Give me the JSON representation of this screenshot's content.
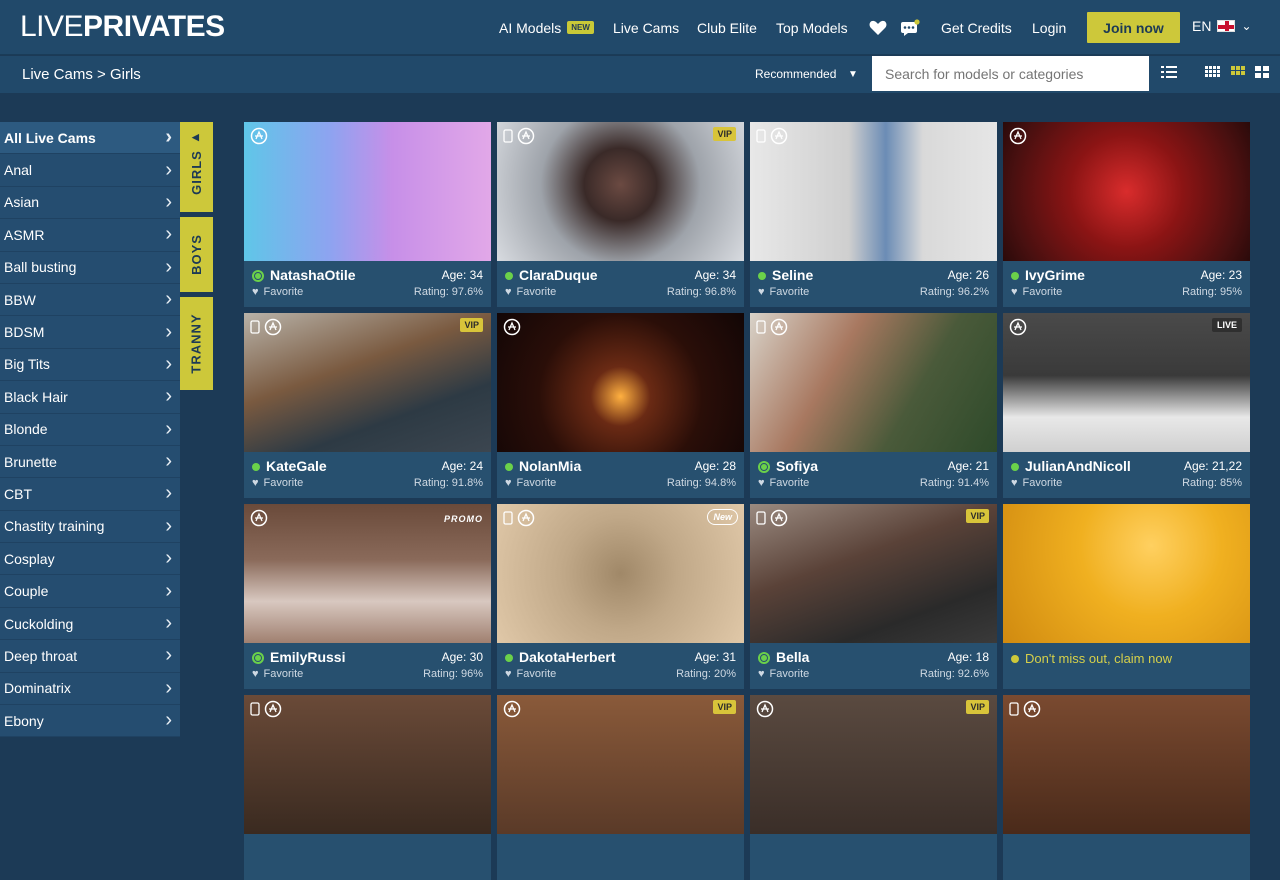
{
  "header": {
    "logo_light": "LIVE",
    "logo_bold": "PRIVATES",
    "nav": [
      {
        "label": "AI Models",
        "badge": "NEW"
      },
      {
        "label": "Live Cams"
      },
      {
        "label": "Club Elite"
      },
      {
        "label": "Top Models"
      },
      {
        "label": "Get Credits"
      },
      {
        "label": "Login"
      }
    ],
    "join_label": "Join now",
    "lang": "EN"
  },
  "subbar": {
    "breadcrumb": "Live Cams > Girls",
    "sort_label": "Recommended",
    "search_placeholder": "Search for models or categories"
  },
  "sidebar": {
    "categories": [
      "All Live Cams",
      "Anal",
      "Asian",
      "ASMR",
      "Ball busting",
      "BBW",
      "BDSM",
      "Big Tits",
      "Black Hair",
      "Blonde",
      "Brunette",
      "CBT",
      "Chastity training",
      "Cosplay",
      "Couple",
      "Cuckolding",
      "Deep throat",
      "Dominatrix",
      "Ebony"
    ],
    "tabs": [
      "GIRLS",
      "BOYS",
      "TRANNY"
    ]
  },
  "models": [
    {
      "name": "NatashaOtile",
      "age": "Age: 34",
      "favorite": "Favorite",
      "rating": "Rating: 97.6%",
      "badge": "",
      "ring": true,
      "bg": "linear-gradient(90deg,#5fc6e8 0%,#8ea3f0 35%,#c78fe8 60%,#e2a8e8 100%)"
    },
    {
      "name": "ClaraDuque",
      "age": "Age: 34",
      "favorite": "Favorite",
      "rating": "Rating: 96.8%",
      "badge": "VIP",
      "ring": false,
      "bg": "radial-gradient(circle at 50% 45%,#6b4a42 0%,#3a2a28 25%,#9ea3aa 55%,#d8dbe0 100%)"
    },
    {
      "name": "Seline",
      "age": "Age: 26",
      "favorite": "Favorite",
      "rating": "Rating: 96.2%",
      "badge": "",
      "ring": false,
      "bg": "linear-gradient(90deg,#e8e8e8 0%,#cfcfcf 40%,#6b8cb5 55%,#d9d9d9 70%,#e6e6e6 100%)"
    },
    {
      "name": "IvyGrime",
      "age": "Age: 23",
      "favorite": "Favorite",
      "rating": "Rating: 95%",
      "badge": "",
      "ring": false,
      "bg": "radial-gradient(circle at 50% 50%,#d92c2c 0%,#8b1414 40%,#4a1010 80%,#2a0a0a 100%)"
    },
    {
      "name": "KateGale",
      "age": "Age: 24",
      "favorite": "Favorite",
      "rating": "Rating: 91.8%",
      "badge": "VIP",
      "ring": false,
      "bg": "linear-gradient(160deg,#b8b2a8 0%,#7a5a40 40%,#2d3a44 70%,#3c4650 100%)"
    },
    {
      "name": "NolanMia",
      "age": "Age: 28",
      "favorite": "Favorite",
      "rating": "Rating: 94.8%",
      "badge": "",
      "ring": false,
      "bg": "radial-gradient(circle at 50% 60%,#ffb040 0%,#6a2a14 20%,#2a0e08 55%,#120606 100%)"
    },
    {
      "name": "Sofiya",
      "age": "Age: 21",
      "favorite": "Favorite",
      "rating": "Rating: 91.4%",
      "badge": "",
      "ring": true,
      "bg": "linear-gradient(120deg,#d8d2c8 0%,#a87860 35%,#4a5a3a 65%,#2e4a2a 100%)"
    },
    {
      "name": "JulianAndNicoll",
      "age": "Age: 21,22",
      "favorite": "Favorite",
      "rating": "Rating: 85%",
      "badge": "LIVE",
      "ring": false,
      "bg": "linear-gradient(180deg,#4a4a4a 0%,#3a3a3a 45%,#e8e8e8 75%,#d0d0d0 100%)"
    },
    {
      "name": "EmilyRussi",
      "age": "Age: 30",
      "favorite": "Favorite",
      "rating": "Rating: 96%",
      "badge": "PROMO",
      "ring": true,
      "bg": "linear-gradient(180deg,#6a4a3a 0%,#8a6a5a 40%,#d8c8c0 70%,#a08070 100%)"
    },
    {
      "name": "DakotaHerbert",
      "age": "Age: 31",
      "favorite": "Favorite",
      "rating": "Rating: 20%",
      "badge": "New",
      "ring": false,
      "bg": "radial-gradient(circle at 50% 50%,#a08868 0%,#c0a888 40%,#e0c8a8 100%)"
    },
    {
      "name": "Bella",
      "age": "Age: 18",
      "favorite": "Favorite",
      "rating": "Rating: 92.6%",
      "badge": "VIP",
      "ring": true,
      "bg": "linear-gradient(160deg,#9a8a80 0%,#5a4238 40%,#2a2a2a 75%,#3a3a3a 100%)"
    }
  ],
  "promo": {
    "text": "Don't miss out, claim now",
    "bg": "radial-gradient(circle at 60% 30%,#ffd060 0%,#f0b020 40%,#d08a10 100%)"
  }
}
